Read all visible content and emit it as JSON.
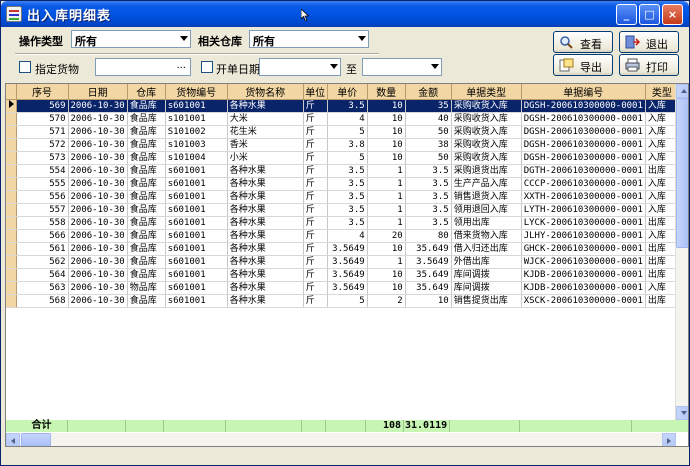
{
  "window": {
    "title": "出入库明细表",
    "minimize": "_",
    "maximize": "□",
    "close": "×"
  },
  "filters": {
    "op_type_label": "操作类型",
    "op_type_value": "所有",
    "warehouse_label": "相关仓库",
    "warehouse_value": "所有",
    "goods_label": "指定货物",
    "goods_value": "",
    "goods_browse": "...",
    "date_label": "开单日期",
    "date_from": "",
    "date_to_label": "至",
    "date_to": ""
  },
  "buttons": {
    "query": "查看",
    "exit": "退出",
    "export": "导出",
    "print": "打印"
  },
  "table": {
    "headers": [
      "序号",
      "日期",
      "仓库",
      "货物编号",
      "货物名称",
      "单位",
      "单价",
      "数量",
      "金额",
      "单据类型",
      "单据编号",
      "类型"
    ],
    "rows": [
      [
        "569",
        "2006-10-30",
        "食品库",
        "s601001",
        "各种水果",
        "斤",
        "3.5",
        "10",
        "35",
        "采购收货入库",
        "DGSH-200610300000-0001",
        "入库"
      ],
      [
        "570",
        "2006-10-30",
        "食品库",
        "s101001",
        "大米",
        "斤",
        "4",
        "10",
        "40",
        "采购收货入库",
        "DGSH-200610300000-0001",
        "入库"
      ],
      [
        "571",
        "2006-10-30",
        "食品库",
        "S101002",
        "花生米",
        "斤",
        "5",
        "10",
        "50",
        "采购收货入库",
        "DGSH-200610300000-0001",
        "入库"
      ],
      [
        "572",
        "2006-10-30",
        "食品库",
        "s101003",
        "香米",
        "斤",
        "3.8",
        "10",
        "38",
        "采购收货入库",
        "DGSH-200610300000-0001",
        "入库"
      ],
      [
        "573",
        "2006-10-30",
        "食品库",
        "s101004",
        "小米",
        "斤",
        "5",
        "10",
        "50",
        "采购收货入库",
        "DGSH-200610300000-0001",
        "入库"
      ],
      [
        "554",
        "2006-10-30",
        "食品库",
        "s601001",
        "各种水果",
        "斤",
        "3.5",
        "1",
        "3.5",
        "采购退货出库",
        "DGTH-200610300000-0001",
        "出库"
      ],
      [
        "555",
        "2006-10-30",
        "食品库",
        "s601001",
        "各种水果",
        "斤",
        "3.5",
        "1",
        "3.5",
        "生产产品入库",
        "CCCP-200610300000-0001",
        "入库"
      ],
      [
        "556",
        "2006-10-30",
        "食品库",
        "s601001",
        "各种水果",
        "斤",
        "3.5",
        "1",
        "3.5",
        "销售退货入库",
        "XXTH-200610300000-0001",
        "入库"
      ],
      [
        "557",
        "2006-10-30",
        "食品库",
        "s601001",
        "各种水果",
        "斤",
        "3.5",
        "1",
        "3.5",
        "领用退回入库",
        "LYTH-200610300000-0001",
        "入库"
      ],
      [
        "558",
        "2006-10-30",
        "食品库",
        "s601001",
        "各种水果",
        "斤",
        "3.5",
        "1",
        "3.5",
        "领用出库",
        "LYCK-200610300000-0001",
        "出库"
      ],
      [
        "566",
        "2006-10-30",
        "食品库",
        "s601001",
        "各种水果",
        "斤",
        "4",
        "20",
        "80",
        "借来货物入库",
        "JLHY-200610300000-0001",
        "入库"
      ],
      [
        "561",
        "2006-10-30",
        "食品库",
        "s601001",
        "各种水果",
        "斤",
        "3.5649",
        "10",
        "35.649",
        "借入归还出库",
        "GHCK-200610300000-0001",
        "出库"
      ],
      [
        "562",
        "2006-10-30",
        "食品库",
        "s601001",
        "各种水果",
        "斤",
        "3.5649",
        "1",
        "3.5649",
        "外借出库",
        "WJCK-200610300000-0001",
        "出库"
      ],
      [
        "564",
        "2006-10-30",
        "食品库",
        "s601001",
        "各种水果",
        "斤",
        "3.5649",
        "10",
        "35.649",
        "库间调拨",
        "KJDB-200610300000-0001",
        "出库"
      ],
      [
        "563",
        "2006-10-30",
        "物品库",
        "s601001",
        "各种水果",
        "斤",
        "3.5649",
        "10",
        "35.649",
        "库间调拨",
        "KJDB-200610300000-0001",
        "入库"
      ],
      [
        "568",
        "2006-10-30",
        "食品库",
        "s601001",
        "各种水果",
        "斤",
        "5",
        "2",
        "10",
        "销售提货出库",
        "XSCK-200610300000-0001",
        "出库"
      ]
    ],
    "selected_row": 0
  },
  "totals": {
    "label": "合计",
    "quantity": "108",
    "amount": "31.0119"
  },
  "colors": {
    "header_bg": "#f2d7a4",
    "selected_bg": "#0a246a",
    "totals_bg": "#c6f5b4",
    "title_bar": "#0054e3"
  }
}
